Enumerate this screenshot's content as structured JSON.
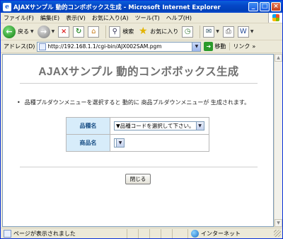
{
  "window": {
    "title": "AJAXサンプル 動的コンボボックス生成 - Microsoft Internet Explorer",
    "controls": {
      "minimize": "_",
      "maximize": "□",
      "close": "×"
    }
  },
  "menu": [
    "ファイル(F)",
    "編集(E)",
    "表示(V)",
    "お気に入り(A)",
    "ツール(T)",
    "ヘルプ(H)"
  ],
  "toolbar": {
    "back_label": "戻る",
    "search_label": "検索",
    "favorites_label": "お気に入り"
  },
  "addressbar": {
    "label": "アドレス(D)",
    "url": "http://192.168.1.1/cgi-bin/AJX002SAM.pgm",
    "go_label": "移動",
    "links_label": "リンク"
  },
  "page": {
    "title": "AJAXサンプル 動的コンボボックス生成",
    "description": "品種プルダウンメニューを選択すると 動的に 商品プルダウンメニューが 生成されます。",
    "form": {
      "category_label": "品種名",
      "category_selected": "▼品種コードを選択して下さい。",
      "product_label": "商品名",
      "product_selected": ""
    },
    "close_button": "閉じる"
  },
  "statusbar": {
    "text": "ページが表示されました",
    "zone": "インターネット"
  },
  "icons": {
    "back": "back-icon",
    "forward": "forward-icon",
    "stop": "stop-icon",
    "refresh": "refresh-icon",
    "home": "home-icon",
    "search": "search-icon",
    "favorites": "favorites-icon",
    "history": "history-icon",
    "mail": "mail-icon",
    "print": "print-icon",
    "edit": "edit-icon",
    "globe": "globe-icon"
  },
  "colors": {
    "titlebar": "#0a5fdc",
    "label_cell_bg": "#d7ecfa",
    "label_text": "#1a4f86",
    "page_title": "#707070"
  }
}
